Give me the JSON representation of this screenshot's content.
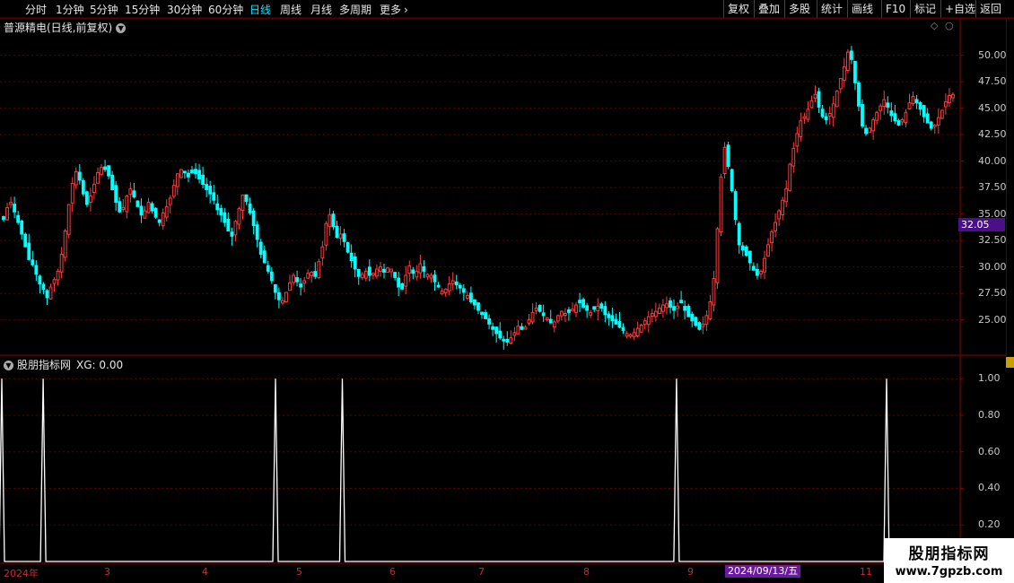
{
  "toolbar": {
    "periods": [
      "分时",
      "1分钟",
      "5分钟",
      "15分钟",
      "30分钟",
      "60分钟",
      "日线",
      "周线",
      "月线",
      "多周期",
      "更多"
    ],
    "active": "日线",
    "right_buttons": [
      "复权",
      "叠加",
      "多股",
      "统计",
      "画线",
      "F10",
      "标记",
      "+自选",
      "返回"
    ]
  },
  "main_chart": {
    "title": "普源精电(日线,前复权)",
    "y_ticks": [
      "50.00",
      "47.50",
      "45.00",
      "42.50",
      "40.00",
      "37.50",
      "35.00",
      "32.50",
      "30.00",
      "27.50",
      "25.00"
    ],
    "current_price": "32.05"
  },
  "indicator": {
    "name": "股朋指标网",
    "formula": "XG: 0.00",
    "y_ticks": [
      "1.00",
      "0.80",
      "0.60",
      "0.40",
      "0.20"
    ]
  },
  "x_axis": {
    "labels": [
      "2024年",
      "3",
      "4",
      "5",
      "6",
      "7",
      "8",
      "9",
      "11"
    ],
    "cursor_date": "2024/09/13/五"
  },
  "watermark": {
    "line1": "股朋指标网",
    "line2": "www.7gpzb.com"
  },
  "colors": {
    "up": "#ff3b3b",
    "down": "#00ffff",
    "grid": "#5a0000",
    "accent": "#00e5ff"
  },
  "chart_data": {
    "type": "candlestick",
    "ylim": [
      22,
      52
    ],
    "x": [
      1,
      2,
      3,
      4,
      5,
      6,
      7,
      8,
      9,
      10,
      11,
      12,
      13,
      14,
      15,
      16,
      17,
      18,
      19,
      20,
      21,
      22,
      23,
      24,
      25,
      26,
      27,
      28,
      29,
      30,
      31,
      32,
      33,
      34,
      35,
      36,
      37,
      38,
      39,
      40,
      41,
      42,
      43,
      44,
      45,
      46,
      47,
      48,
      49,
      50,
      51,
      52,
      53,
      54,
      55,
      56,
      57,
      58,
      59,
      60,
      61,
      62,
      63,
      64,
      65,
      66,
      67,
      68,
      69,
      70,
      71,
      72,
      73,
      74,
      75,
      76,
      77,
      78,
      79,
      80,
      81,
      82,
      83,
      84,
      85,
      86,
      87,
      88,
      89,
      90,
      91,
      92,
      93,
      94,
      95,
      96,
      97,
      98,
      99,
      100,
      101,
      102,
      103,
      104,
      105,
      106,
      107,
      108,
      109,
      110,
      111,
      112,
      113,
      114,
      115,
      116,
      117,
      118,
      119,
      120,
      121,
      122,
      123,
      124,
      125,
      126,
      127,
      128,
      129,
      130,
      131,
      132,
      133,
      134,
      135,
      136,
      137,
      138,
      139,
      140,
      141,
      142,
      143,
      144,
      145,
      146,
      147,
      148,
      149,
      150,
      151,
      152,
      153,
      154,
      155,
      156,
      157,
      158,
      159,
      160,
      161,
      162,
      163,
      164,
      165,
      166,
      167,
      168,
      169,
      170,
      171,
      172,
      173,
      174,
      175,
      176,
      177,
      178,
      179,
      180,
      181,
      182,
      183,
      184,
      185,
      186,
      187,
      188,
      189,
      190,
      191,
      192,
      193,
      194,
      195,
      196,
      197,
      198,
      199,
      200,
      201,
      202,
      203,
      204,
      205,
      206,
      207,
      208,
      209,
      210,
      211,
      212,
      213,
      214,
      215,
      216,
      217,
      218,
      219,
      220,
      221,
      222,
      223,
      224,
      225,
      226,
      227,
      228,
      229,
      230,
      231,
      232,
      233,
      234,
      235,
      236,
      237,
      238,
      239,
      240,
      241,
      242,
      243,
      244,
      245,
      246,
      247,
      248,
      249,
      250,
      251,
      252,
      253,
      254,
      255,
      256,
      257,
      258,
      259,
      260,
      261,
      262,
      263,
      264,
      265,
      266,
      267,
      268,
      269,
      270
    ],
    "close": [
      34.5,
      35.6,
      36.1,
      35.2,
      34.2,
      33.1,
      31.9,
      30.7,
      30.2,
      29.3,
      28.4,
      27.9,
      27.1,
      28.1,
      28.8,
      29.6,
      31.2,
      33.4,
      35.9,
      37.9,
      39.0,
      38.2,
      36.9,
      35.9,
      36.7,
      37.8,
      38.9,
      39.4,
      39.2,
      38.6,
      37.3,
      36.1,
      35.2,
      35.6,
      36.7,
      37.4,
      36.6,
      35.7,
      34.9,
      35.3,
      36.1,
      35.3,
      34.7,
      34.2,
      35.1,
      35.7,
      36.5,
      37.7,
      38.8,
      39.2,
      38.9,
      38.5,
      38.9,
      38.8,
      38.3,
      37.8,
      37.3,
      36.9,
      36.3,
      35.4,
      34.9,
      34.2,
      33.4,
      32.9,
      34.3,
      35.5,
      36.8,
      36.2,
      35.1,
      33.9,
      32.6,
      31.2,
      30.4,
      29.6,
      28.7,
      27.6,
      26.9,
      26.8,
      27.6,
      28.5,
      29.2,
      28.6,
      28.1,
      28.7,
      29.4,
      29.5,
      29.1,
      30.5,
      31.9,
      34.1,
      34.9,
      33.8,
      32.8,
      33.1,
      32.4,
      31.4,
      30.6,
      29.8,
      29.1,
      29.3,
      29.6,
      29.2,
      29.4,
      29.8,
      30.0,
      29.5,
      29.9,
      29.8,
      29.0,
      28.1,
      27.9,
      29.2,
      30.1,
      29.4,
      29.6,
      30.3,
      29.6,
      29.3,
      29.2,
      28.6,
      28.1,
      27.7,
      27.9,
      28.4,
      28.7,
      28.3,
      28.0,
      27.6,
      27.3,
      26.7,
      26.4,
      25.9,
      25.5,
      25.1,
      24.6,
      24.1,
      23.7,
      23.3,
      23.0,
      22.9,
      23.3,
      23.8,
      24.4,
      24.1,
      24.3,
      25.0,
      25.7,
      26.1,
      25.8,
      25.4,
      25.2,
      24.7,
      24.8,
      25.4,
      25.8,
      25.6,
      25.7,
      26.0,
      26.4,
      26.6,
      26.2,
      25.9,
      25.7,
      26.0,
      26.3,
      26.1,
      25.5,
      25.2,
      24.9,
      24.6,
      24.3,
      24.0,
      23.7,
      23.6,
      23.8,
      24.2,
      24.5,
      24.9,
      25.3,
      25.6,
      25.8,
      26.1,
      26.4,
      26.5,
      26.2,
      25.9,
      26.3,
      26.6,
      25.9,
      25.3,
      24.9,
      24.5,
      24.1,
      24.6,
      25.4,
      26.7,
      28.9,
      33.6,
      38.5,
      41.3,
      39.5,
      37.2,
      34.5,
      32.1,
      31.6,
      31.1,
      30.4,
      29.7,
      29.2,
      29.6,
      30.8,
      32.1,
      33.3,
      34.2,
      35.3,
      36.3,
      37.4,
      39.7,
      41.2,
      42.6,
      43.8,
      44.2,
      44.9,
      45.7,
      46.3,
      45.1,
      44.2,
      43.9,
      44.5,
      45.4,
      46.6,
      47.8,
      48.9,
      50.3,
      49.6,
      47.4,
      45.2,
      43.3,
      42.6,
      43.1,
      43.9,
      44.6,
      45.2,
      45.8,
      45.1,
      44.3,
      43.8,
      43.4,
      43.9,
      44.6,
      45.5,
      46.1,
      45.5,
      44.9,
      44.2,
      43.6,
      43.1,
      43.4,
      44.1,
      44.8,
      45.6,
      46.2,
      46.3
    ],
    "series": [
      {
        "name": "XG",
        "type": "line",
        "spikes_at_x": [
          1,
          14,
          87,
          108,
          213,
          279
        ],
        "ylim": [
          0,
          1.05
        ]
      }
    ]
  }
}
